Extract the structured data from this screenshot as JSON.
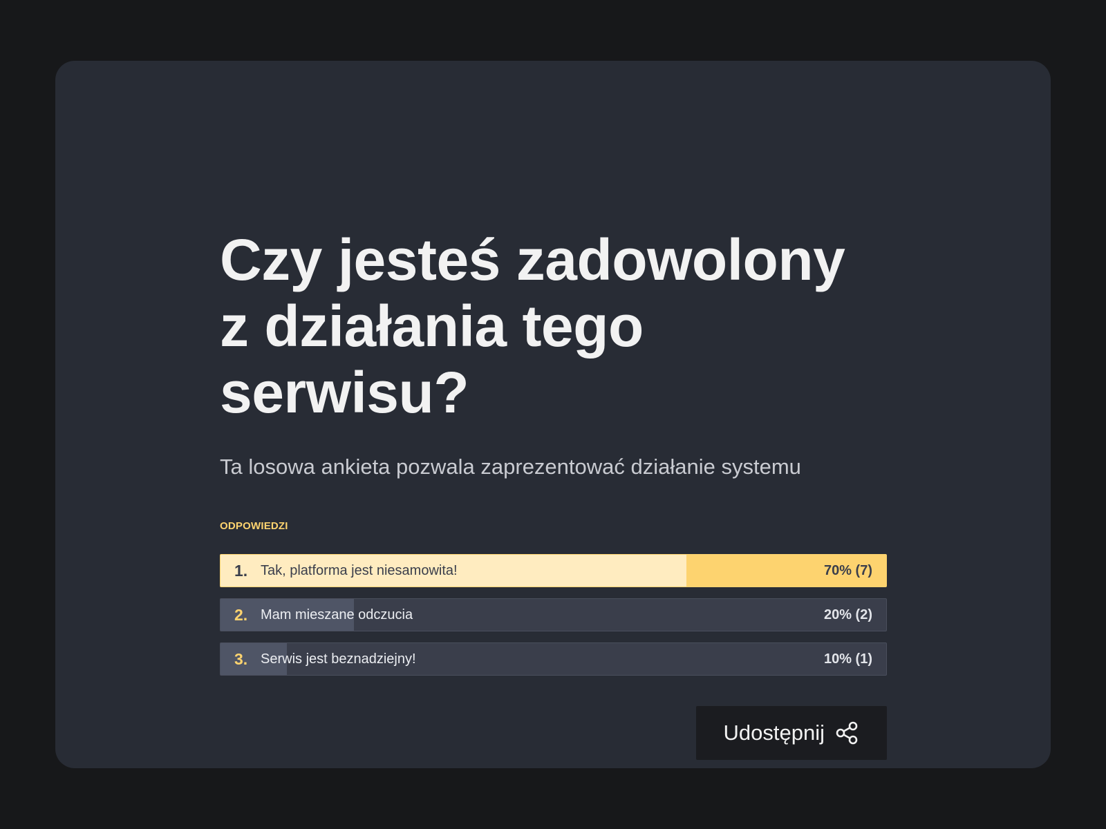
{
  "poll": {
    "question": "Czy jesteś zadowolony z działania tego serwisu?",
    "description": "Ta losowa ankieta pozwala zaprezentować działanie systemu",
    "answers_heading": "ODPOWIEDZI",
    "answers": [
      {
        "number": "1.",
        "label": "Tak, platforma jest niesamowita!",
        "result": "70% (7)",
        "percent": 70,
        "leading": true
      },
      {
        "number": "2.",
        "label": "Mam mieszane odczucia",
        "result": "20% (2)",
        "percent": 20,
        "leading": false
      },
      {
        "number": "3.",
        "label": "Serwis jest beznadziejny!",
        "result": "10% (1)",
        "percent": 10,
        "leading": false
      }
    ]
  },
  "share": {
    "label": "Udostępnij",
    "icon": "share-icon"
  },
  "colors": {
    "background": "#17181a",
    "card": "#282c35",
    "accent": "#fdd36f",
    "accent_light": "#ffecc0",
    "bar_track": "#3a3e4b",
    "bar_fill": "#4f5566",
    "button": "#1b1c20"
  }
}
